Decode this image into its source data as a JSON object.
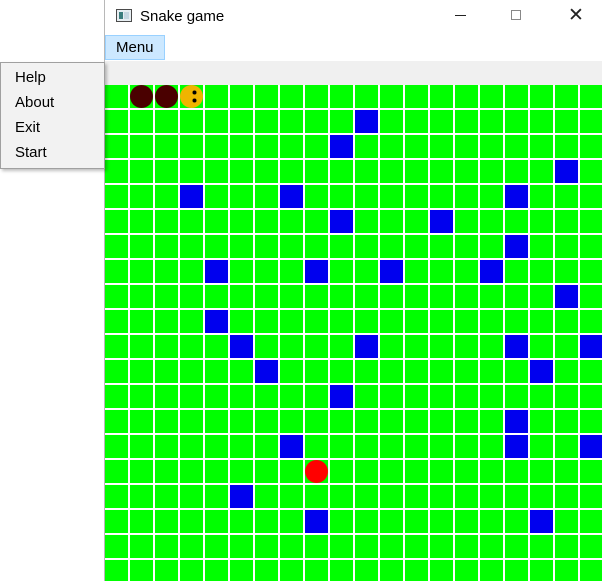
{
  "window": {
    "title": "Snake game"
  },
  "titlebar": {
    "minimize_label": "Minimize",
    "maximize_label": "Maximize",
    "close_glyph": "✕"
  },
  "menubar": {
    "menu_label": "Menu"
  },
  "popup_menu": {
    "items": [
      "Help",
      "About",
      "Exit",
      "Start"
    ]
  },
  "game": {
    "columns": 20,
    "rows": 20,
    "colors": {
      "field": "#00ff00",
      "grid_line": "#ffffff",
      "obstacle": "#0000ee",
      "snake_body": "#4a0000",
      "snake_head": "#f0b400",
      "snake_eye": "#000000",
      "food": "#ff0000"
    },
    "snake": {
      "head": [
        3,
        0
      ],
      "body": [
        [
          1,
          0
        ],
        [
          2,
          0
        ]
      ]
    },
    "food": [
      8,
      15
    ],
    "obstacles": [
      [
        10,
        1
      ],
      [
        9,
        2
      ],
      [
        18,
        3
      ],
      [
        3,
        4
      ],
      [
        7,
        4
      ],
      [
        16,
        4
      ],
      [
        9,
        5
      ],
      [
        13,
        5
      ],
      [
        16,
        6
      ],
      [
        4,
        7
      ],
      [
        8,
        7
      ],
      [
        11,
        7
      ],
      [
        15,
        7
      ],
      [
        18,
        8
      ],
      [
        4,
        9
      ],
      [
        5,
        10
      ],
      [
        10,
        10
      ],
      [
        16,
        10
      ],
      [
        19,
        10
      ],
      [
        6,
        11
      ],
      [
        17,
        11
      ],
      [
        9,
        12
      ],
      [
        16,
        13
      ],
      [
        7,
        14
      ],
      [
        16,
        14
      ],
      [
        19,
        14
      ],
      [
        5,
        16
      ],
      [
        8,
        17
      ],
      [
        17,
        17
      ]
    ]
  }
}
